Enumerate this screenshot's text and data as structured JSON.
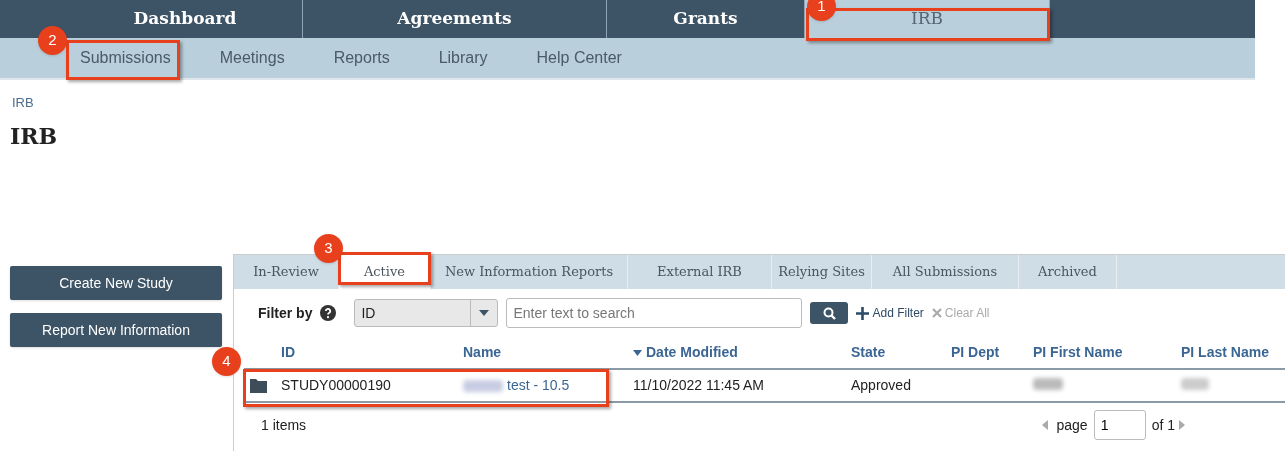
{
  "top_nav": [
    {
      "label": "Dashboard",
      "selected": false
    },
    {
      "label": "Agreements",
      "selected": false
    },
    {
      "label": "Grants",
      "selected": false
    },
    {
      "label": "IRB",
      "selected": true
    }
  ],
  "sub_nav": [
    "Submissions",
    "Meetings",
    "Reports",
    "Library",
    "Help Center"
  ],
  "breadcrumb": "IRB",
  "heading": "IRB",
  "actions": [
    "Create New Study",
    "Report New Information"
  ],
  "tabs": [
    {
      "label": "In-Review",
      "selected": false
    },
    {
      "label": "Active",
      "selected": true
    },
    {
      "label": "New Information Reports",
      "selected": false
    },
    {
      "label": "External IRB",
      "selected": false
    },
    {
      "label": "Relying Sites",
      "selected": false
    },
    {
      "label": "All Submissions",
      "selected": false
    },
    {
      "label": "Archived",
      "selected": false
    }
  ],
  "filter": {
    "label": "Filter by",
    "field": "ID",
    "placeholder": "Enter text to search",
    "add_filter": "Add Filter",
    "clear_all": "Clear All"
  },
  "table": {
    "columns": [
      "ID",
      "Name",
      "Date Modified",
      "State",
      "PI Dept",
      "PI First Name",
      "PI Last Name"
    ],
    "rows": [
      {
        "id": "STUDY00000190",
        "name": "test - 10.5",
        "date_modified": "11/10/2022 11:45 AM",
        "state": "Approved"
      }
    ]
  },
  "footer": {
    "count": "1 items",
    "page_label": "page",
    "page": "1",
    "of": "of 1"
  },
  "annotations": [
    "1",
    "2",
    "3",
    "4"
  ]
}
